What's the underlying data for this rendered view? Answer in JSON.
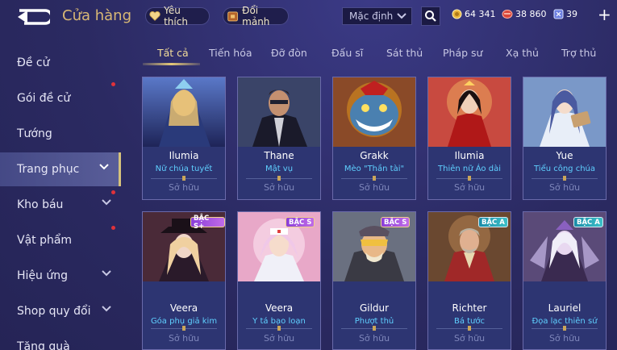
{
  "header": {
    "title": "Cửa hàng",
    "favorites_label": "Yêu thích",
    "fragments_label": "Đổi mảnh",
    "sort_selected": "Mặc định",
    "currencies": [
      {
        "name": "gold",
        "value": "64 341"
      },
      {
        "name": "vouchers",
        "value": "38 860"
      },
      {
        "name": "diamonds",
        "value": "39"
      }
    ]
  },
  "sidebar": {
    "items": [
      {
        "label": "Đề cử",
        "active": false,
        "chevron": false,
        "badge": false
      },
      {
        "label": "Gói đề cử",
        "active": false,
        "chevron": false,
        "badge": true
      },
      {
        "label": "Tướng",
        "active": false,
        "chevron": false,
        "badge": false
      },
      {
        "label": "Trang phục",
        "active": true,
        "chevron": true,
        "badge": false
      },
      {
        "label": "Kho báu",
        "active": false,
        "chevron": true,
        "badge": true
      },
      {
        "label": "Vật phẩm",
        "active": false,
        "chevron": false,
        "badge": true
      },
      {
        "label": "Hiệu ứng",
        "active": false,
        "chevron": true,
        "badge": false
      },
      {
        "label": "Shop quy đổi",
        "active": false,
        "chevron": true,
        "badge": false
      },
      {
        "label": "Tặng quà",
        "active": false,
        "chevron": false,
        "badge": false
      }
    ]
  },
  "tabs": [
    "Tất cả",
    "Tiến hóa",
    "Đỡ đòn",
    "Đấu sĩ",
    "Sát thủ",
    "Pháp sư",
    "Xạ thủ",
    "Trợ thủ"
  ],
  "active_tab": "Tất cả",
  "cards": [
    {
      "hero": "Ilumia",
      "skin": "Nữ chúa tuyết",
      "status": "Sở hữu",
      "badge": ""
    },
    {
      "hero": "Thane",
      "skin": "Mật vụ",
      "status": "Sở hữu",
      "badge": ""
    },
    {
      "hero": "Grakk",
      "skin": "Mèo \"Thần tài\"",
      "status": "Sở hữu",
      "badge": ""
    },
    {
      "hero": "Ilumia",
      "skin": "Thiên nữ Áo dài",
      "status": "Sở hữu",
      "badge": ""
    },
    {
      "hero": "Yue",
      "skin": "Tiểu công chúa",
      "status": "Sở hữu",
      "badge": ""
    },
    {
      "hero": "Veera",
      "skin": "Góa phụ giả kim",
      "status": "Sở hữu",
      "badge": "BẬC S+"
    },
    {
      "hero": "Veera",
      "skin": "Y tá bạo loạn",
      "status": "Sở hữu",
      "badge": "BẬC S"
    },
    {
      "hero": "Gildur",
      "skin": "Phượt thủ",
      "status": "Sở hữu",
      "badge": "BẬC S"
    },
    {
      "hero": "Richter",
      "skin": "Bá tước",
      "status": "Sở hữu",
      "badge": "BẬC A"
    },
    {
      "hero": "Lauriel",
      "skin": "Đọa lạc thiên sứ",
      "status": "Sở hữu",
      "badge": "BẬC A"
    }
  ],
  "colors": {
    "background": "#2c2b66",
    "title_gold": "#d9b875",
    "skin_name": "#5fd0ff",
    "owned_text": "#7e86ba",
    "notification_dot": "#e0323a",
    "active_tab": "#f2dc9a"
  }
}
